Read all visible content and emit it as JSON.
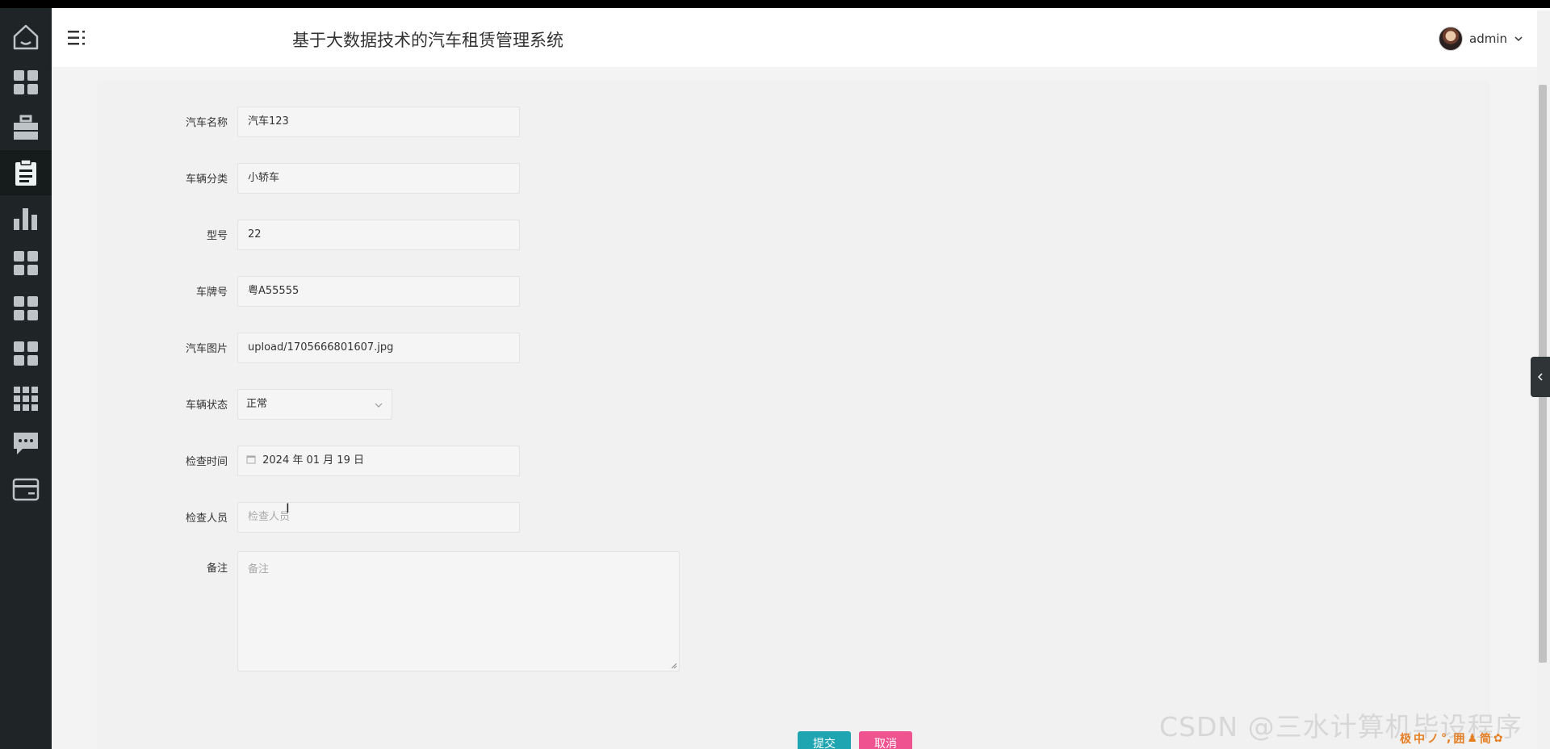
{
  "app": {
    "title": "基于大数据技术的汽车租赁管理系统",
    "user": "admin"
  },
  "sidebar": {
    "items": [
      {
        "icon": "home-icon"
      },
      {
        "icon": "grid-icon"
      },
      {
        "icon": "briefcase-icon"
      },
      {
        "icon": "clipboard-icon",
        "active": true
      },
      {
        "icon": "bar-chart-icon"
      },
      {
        "icon": "grid-icon"
      },
      {
        "icon": "grid-icon"
      },
      {
        "icon": "grid-icon"
      },
      {
        "icon": "apps-icon"
      },
      {
        "icon": "chat-icon"
      },
      {
        "icon": "card-icon"
      }
    ]
  },
  "form": {
    "car_name": {
      "label": "汽车名称",
      "value": "汽车123"
    },
    "category": {
      "label": "车辆分类",
      "value": "小轿车"
    },
    "model": {
      "label": "型号",
      "value": "22"
    },
    "plate": {
      "label": "车牌号",
      "value": "粤A55555"
    },
    "image": {
      "label": "汽车图片",
      "value": "upload/1705666801607.jpg"
    },
    "status": {
      "label": "车辆状态",
      "value": "正常"
    },
    "check_time": {
      "label": "检查时间",
      "value": "2024 年 01 月 19 日"
    },
    "inspector": {
      "label": "检查人员",
      "placeholder": "检查人员"
    },
    "remark": {
      "label": "备注",
      "placeholder": "备注"
    }
  },
  "buttons": {
    "submit": "提交",
    "cancel": "取消"
  },
  "watermark": "CSDN @三水计算机毕设程序",
  "ime": [
    "极",
    "中",
    "ノ",
    "°,",
    "囲",
    "♟",
    "简",
    "✿"
  ],
  "colors": {
    "sidebar_bg": "#1f2527",
    "submit": "#1fa4b2",
    "cancel": "#ef5491"
  }
}
